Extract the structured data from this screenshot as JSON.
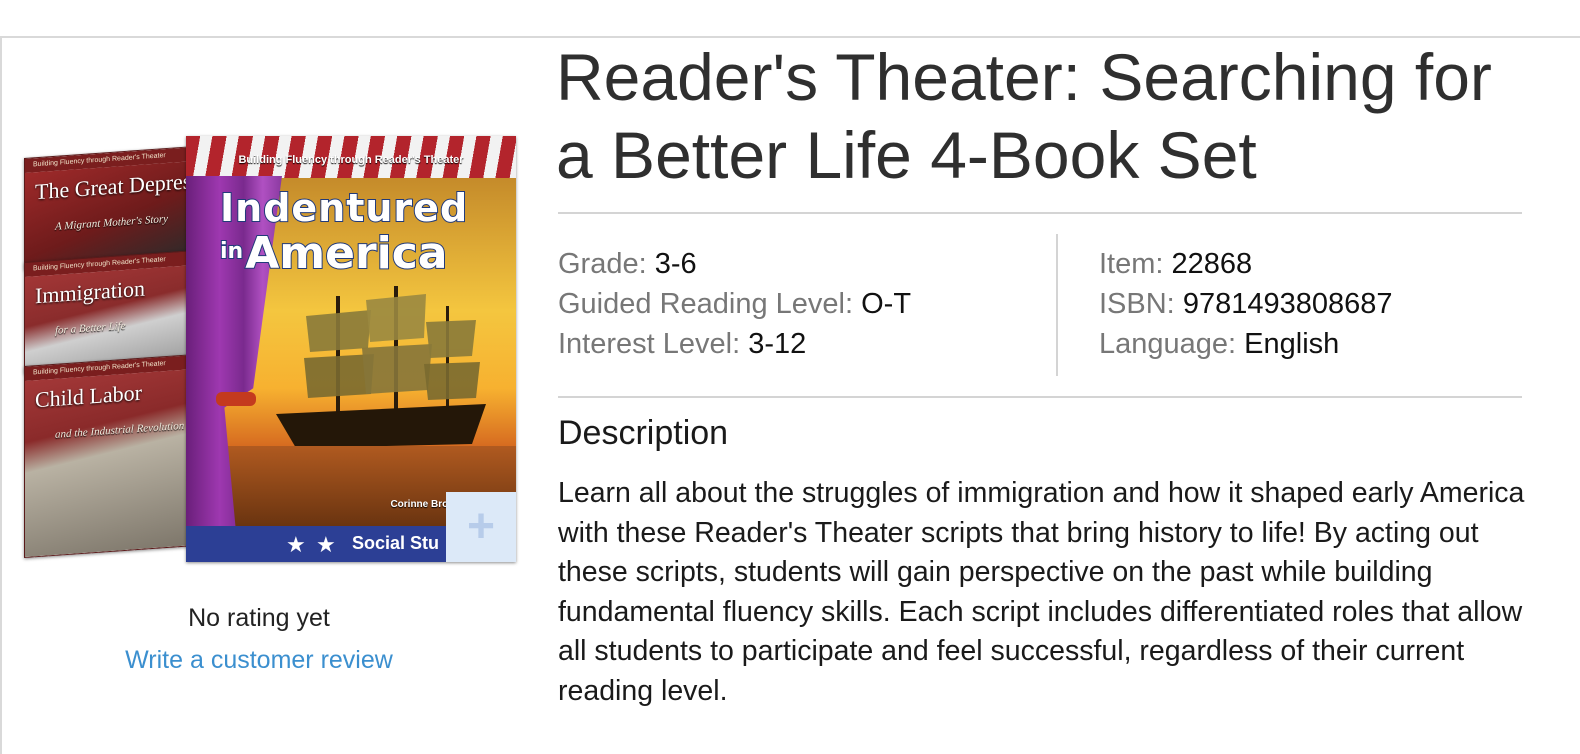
{
  "product": {
    "title": "Reader's Theater: Searching for a Better Life 4-Book Set"
  },
  "image": {
    "main_cover": {
      "series": "Building Fluency through Reader's Theater",
      "title_line1": "Indentured",
      "title_prefix": "in",
      "title_line2": "America",
      "author": "Corinne Brow",
      "band": "Social Stu"
    },
    "side_covers": [
      {
        "title": "The Great Depression",
        "subtitle": "A Migrant Mother's Story"
      },
      {
        "title": "Immigration",
        "subtitle": "for a Better Life"
      },
      {
        "title": "Child Labor",
        "subtitle": "and the Industrial Revolution"
      }
    ],
    "zoom_icon": "plus-icon"
  },
  "rating": {
    "text": "No rating yet",
    "review_link": "Write a customer review"
  },
  "specs": {
    "left": [
      {
        "label": "Grade: ",
        "value": "3-6"
      },
      {
        "label": "Guided Reading Level: ",
        "value": "O-T"
      },
      {
        "label": "Interest Level: ",
        "value": "3-12"
      }
    ],
    "right": [
      {
        "label": "Item: ",
        "value": "22868"
      },
      {
        "label": "ISBN: ",
        "value": "9781493808687"
      },
      {
        "label": "Language: ",
        "value": "English"
      }
    ]
  },
  "description": {
    "heading": "Description",
    "text": "Learn all about the struggles of immigration and how it shaped early America with these Reader's Theater scripts that bring history to life! By acting out these scripts, students will gain perspective on the past while building fundamental fluency skills. Each script includes differentiated roles that allow all students to participate and feel successful, regardless of their current reading level."
  },
  "colors": {
    "link": "#3b8fcf",
    "label": "#777777",
    "title": "#2f2f2f",
    "divider": "#d4d4d4",
    "zoom_button": "#dce9f8"
  }
}
